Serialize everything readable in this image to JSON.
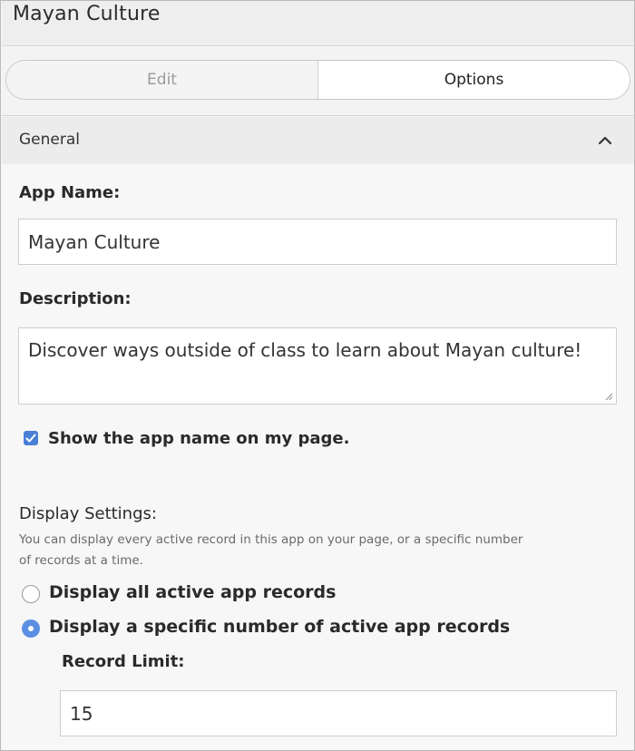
{
  "app": {
    "title": "Mayan Culture"
  },
  "tabs": [
    {
      "label": "Edit",
      "active": false
    },
    {
      "label": "Options",
      "active": true
    }
  ],
  "section": {
    "title": "General",
    "icon": "chevron-up-icon"
  },
  "form": {
    "app_name_label": "App Name:",
    "app_name_value": "Mayan Culture",
    "description_label": "Description:",
    "description_value": "Discover ways outside of class to learn about Mayan culture!",
    "show_name_label": "Show the app name on my page.",
    "show_name_checked": true,
    "display_settings_label": "Display Settings:",
    "display_settings_help_line1": "You can display every active record in this app on your page, or a specific number",
    "display_settings_help_line2": "of records at a time.",
    "radio_all_label": "Display all active app records",
    "radio_specific_label": "Display a specific number of active app records",
    "selected_option": "specific",
    "record_limit_label": "Record Limit:",
    "record_limit_value": "15"
  },
  "colors": {
    "accent": "#5b8fe3",
    "checkbox": "#4a7fd6"
  }
}
